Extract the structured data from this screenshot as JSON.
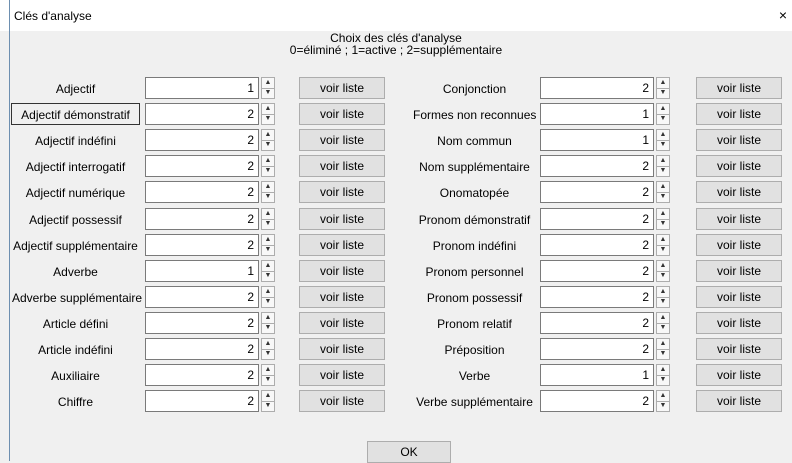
{
  "window": {
    "title": "Clés d'analyse",
    "close_glyph": "×"
  },
  "heading": {
    "line1": "Choix des clés d'analyse",
    "line2": "0=éliminé ; 1=active ; 2=supplémentaire"
  },
  "list_button_label": "voir liste",
  "ok_label": "OK",
  "left_column": [
    {
      "label": "Adjectif",
      "value": "1"
    },
    {
      "label": "Adjectif démonstratif",
      "value": "2"
    },
    {
      "label": "Adjectif indéfini",
      "value": "2"
    },
    {
      "label": "Adjectif interrogatif",
      "value": "2"
    },
    {
      "label": "Adjectif numérique",
      "value": "2"
    },
    {
      "label": "Adjectif possessif",
      "value": "2"
    },
    {
      "label": "Adjectif supplémentaire",
      "value": "2"
    },
    {
      "label": "Adverbe",
      "value": "1"
    },
    {
      "label": "Adverbe supplémentaire",
      "value": "2"
    },
    {
      "label": "Article défini",
      "value": "2"
    },
    {
      "label": "Article indéfini",
      "value": "2"
    },
    {
      "label": "Auxiliaire",
      "value": "2"
    },
    {
      "label": "Chiffre",
      "value": "2"
    }
  ],
  "right_column": [
    {
      "label": "Conjonction",
      "value": "2"
    },
    {
      "label": "Formes non reconnues",
      "value": "1"
    },
    {
      "label": "Nom commun",
      "value": "1"
    },
    {
      "label": "Nom supplémentaire",
      "value": "2"
    },
    {
      "label": "Onomatopée",
      "value": "2"
    },
    {
      "label": "Pronom démonstratif",
      "value": "2"
    },
    {
      "label": "Pronom indéfini",
      "value": "2"
    },
    {
      "label": "Pronom personnel",
      "value": "2"
    },
    {
      "label": "Pronom possessif",
      "value": "2"
    },
    {
      "label": "Pronom relatif",
      "value": "2"
    },
    {
      "label": "Préposition",
      "value": "2"
    },
    {
      "label": "Verbe",
      "value": "1"
    },
    {
      "label": "Verbe supplémentaire",
      "value": "2"
    }
  ],
  "icons": {
    "spin_up": "▲",
    "spin_down": "▼",
    "close": "close-icon"
  }
}
